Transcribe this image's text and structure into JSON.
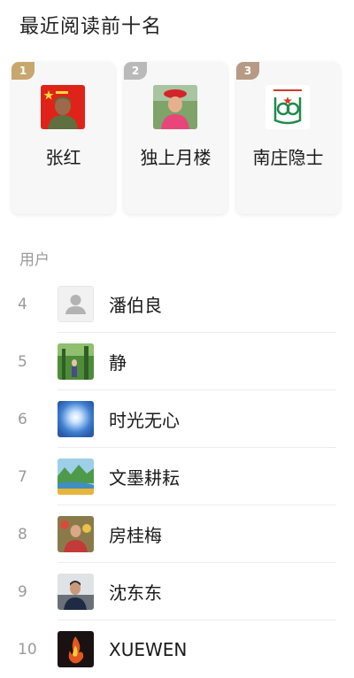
{
  "header": {
    "title": "最近阅读前十名"
  },
  "top3": [
    {
      "rank": "1",
      "name": "张红",
      "badge_color": "#c8a76e",
      "avatar_icon": "soldier-avatar-icon"
    },
    {
      "rank": "2",
      "name": "独上月楼",
      "badge_color": "#b9b9b9",
      "avatar_icon": "woman-red-hat-avatar-icon"
    },
    {
      "rank": "3",
      "name": "南庄隐士",
      "badge_color": "#b79a86",
      "avatar_icon": "anniversary-logo-avatar-icon"
    }
  ],
  "section": {
    "label": "用户"
  },
  "list": [
    {
      "rank": "4",
      "name": "潘伯良",
      "avatar_icon": "default-user-avatar-icon"
    },
    {
      "rank": "5",
      "name": "静",
      "avatar_icon": "forest-photo-avatar-icon"
    },
    {
      "rank": "6",
      "name": "时光无心",
      "avatar_icon": "sun-sky-avatar-icon"
    },
    {
      "rank": "7",
      "name": "文墨耕耘",
      "avatar_icon": "landscape-river-avatar-icon"
    },
    {
      "rank": "8",
      "name": "房桂梅",
      "avatar_icon": "person-flowers-avatar-icon"
    },
    {
      "rank": "9",
      "name": "沈东东",
      "avatar_icon": "man-portrait-avatar-icon"
    },
    {
      "rank": "10",
      "name": "XUEWEN",
      "avatar_icon": "fire-dark-avatar-icon"
    }
  ]
}
